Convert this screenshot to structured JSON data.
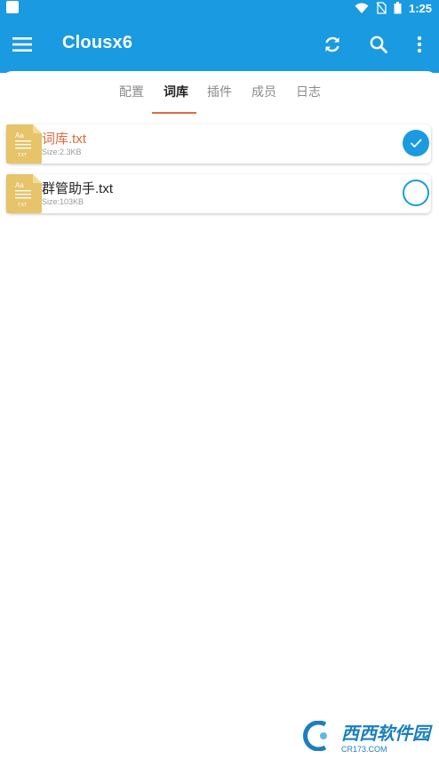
{
  "status_bar": {
    "time": "1:25"
  },
  "app_bar": {
    "title": "Clousx6",
    "icons": [
      "menu-icon",
      "refresh-icon",
      "search-icon",
      "more-vertical-icon"
    ]
  },
  "tabs": [
    {
      "label": "配置",
      "active": false
    },
    {
      "label": "词库",
      "active": true
    },
    {
      "label": "插件",
      "active": false
    },
    {
      "label": "成员",
      "active": false
    },
    {
      "label": "日志",
      "active": false
    }
  ],
  "files": [
    {
      "name": "词库.txt",
      "size": "Size:2.3KB",
      "selected": true,
      "icon_label_top": "Aa",
      "icon_label_bottom": "TXT"
    },
    {
      "name": "群管助手.txt",
      "size": "Size:103KB",
      "selected": false,
      "icon_label_top": "Aa",
      "icon_label_bottom": "TXT"
    }
  ],
  "watermark": {
    "main": "西西软件园",
    "sub": "CR173.COM"
  },
  "colors": {
    "primary": "#1a9ae0",
    "accent": "#e2693a",
    "file_icon": "#e7c46a"
  }
}
